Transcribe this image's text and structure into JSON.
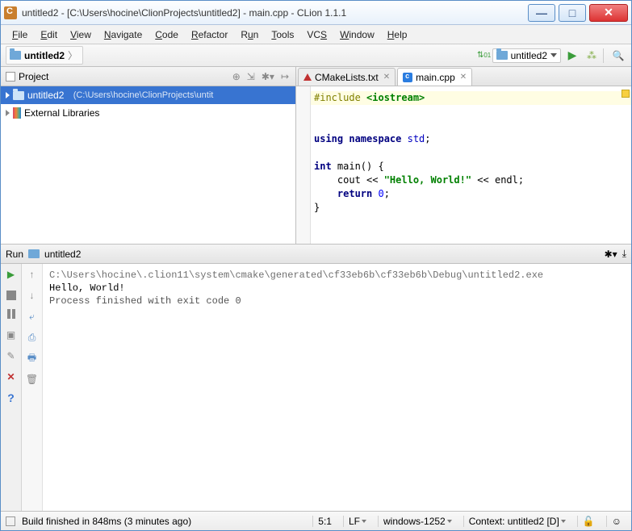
{
  "window": {
    "title": "untitled2 - [C:\\Users\\hocine\\ClionProjects\\untitled2] - main.cpp - CLion 1.1.1"
  },
  "menu": {
    "file": "File",
    "edit": "Edit",
    "view": "View",
    "navigate": "Navigate",
    "code": "Code",
    "refactor": "Refactor",
    "run": "Run",
    "tools": "Tools",
    "vcs": "VCS",
    "window": "Window",
    "help": "Help"
  },
  "nav": {
    "crumb": "untitled2",
    "config": "untitled2"
  },
  "project": {
    "panel_title": "Project",
    "root_name": "untitled2",
    "root_sub": "(C:\\Users\\hocine\\ClionProjects\\untit",
    "extlib": "External Libraries"
  },
  "tabs": {
    "cmake": "CMakeLists.txt",
    "main": "main.cpp"
  },
  "code": {
    "l1a": "#include ",
    "l1b": "<iostream>",
    "l3a": "using ",
    "l3b": "namespace ",
    "l3c": "std",
    "l5a": "int ",
    "l5b": "main() {",
    "l6a": "    cout << ",
    "l6b": "\"Hello, World!\"",
    "l6c": " << endl;",
    "l7a": "    return ",
    "l7b": "0",
    "l7c": ";",
    "l8": "}"
  },
  "runhdr": {
    "label": "Run",
    "target": "untitled2"
  },
  "console": {
    "path": "C:\\Users\\hocine\\.clion11\\system\\cmake\\generated\\cf33eb6b\\cf33eb6b\\Debug\\untitled2.exe",
    "out": "Hello, World!",
    "blank": "",
    "exit": "Process finished with exit code 0"
  },
  "status": {
    "build": "Build finished in 848ms (3 minutes ago)",
    "pos": "5:1",
    "lf": "LF",
    "enc": "windows-1252",
    "ctx": "Context: untitled2 [D]"
  }
}
